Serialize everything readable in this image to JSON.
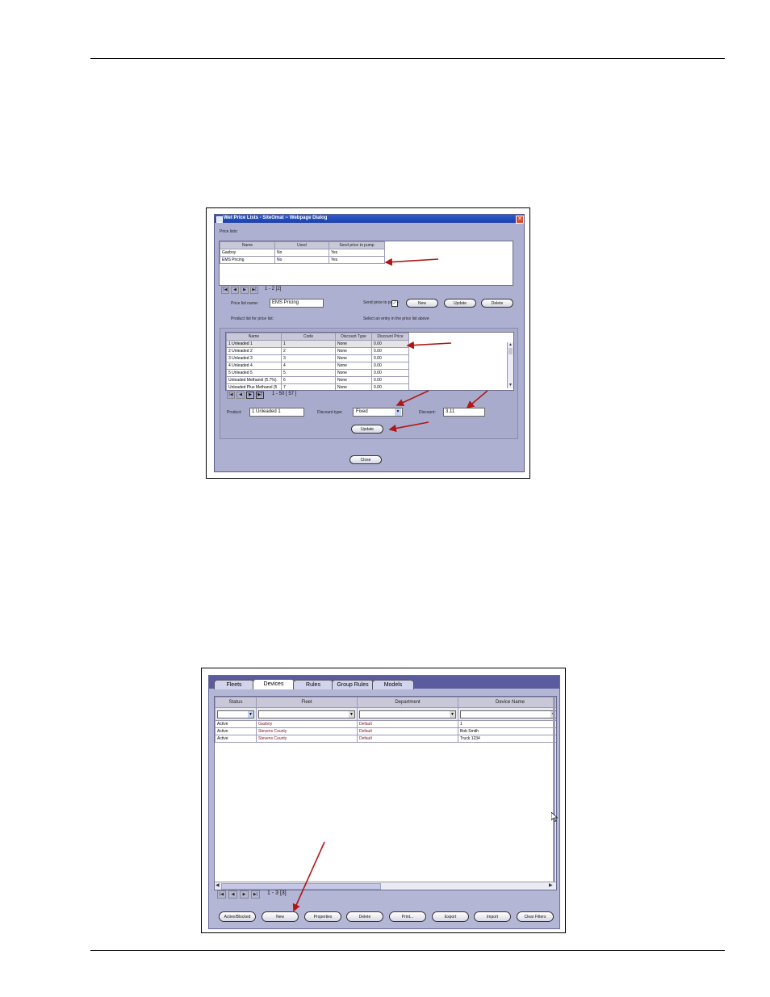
{
  "dialog1": {
    "title": "Wet Price Lists - SiteOmat -- Webpage Dialog",
    "price_lists_label": "Price lists:",
    "price_table": {
      "columns": [
        "Name",
        "Used",
        "Send price to pump"
      ],
      "rows": [
        [
          "Gasboy",
          "No",
          "Yes"
        ],
        [
          "EMS Pricing",
          "No",
          "Yes"
        ]
      ]
    },
    "pager1": "1 - 2 [2]",
    "price_list_name_label": "Price list name:",
    "price_list_name_value": "EMS Pricing",
    "send_price_label": "Send price to pump:",
    "new_button": "New",
    "update_button": "Update",
    "delete_button": "Delete",
    "product_list_label": "Product list for price list:",
    "select_entry_label": "Select an entry in the price list above",
    "product_table": {
      "columns": [
        "Name",
        "Code",
        "Discount Type",
        "Discount Price"
      ],
      "rows": [
        [
          "1 Unleaded 1",
          "1",
          "None",
          "0.00"
        ],
        [
          "2 Unleaded 2",
          "2",
          "None",
          "0.00"
        ],
        [
          "3 Unleaded 3",
          "3",
          "None",
          "0.00"
        ],
        [
          "4 Unleaded 4",
          "4",
          "None",
          "0.00"
        ],
        [
          "5 Unleaded 5",
          "5",
          "None",
          "0.00"
        ],
        [
          "Unleaded Methanol (5.7%)",
          "6",
          "None",
          "0.00"
        ],
        [
          "Unleaded Plus Methanol (5",
          "7",
          "None",
          "0.00"
        ]
      ]
    },
    "pager2": "1 - 50 [ 57 ]",
    "product_label": "Product:",
    "product_value": "1 Unleaded 1",
    "discount_type_label": "Discount type:",
    "discount_type_value": "Fixed",
    "discount_label": "Discount:",
    "discount_value": "3.11",
    "update_button2": "Update",
    "close_button": "Close"
  },
  "dialog2": {
    "tabs": [
      "Fleets",
      "Devices",
      "Rules",
      "Group Rules",
      "Models"
    ],
    "active_tab": "Devices",
    "columns": [
      "Status",
      "Fleet",
      "Department",
      "Device Name"
    ],
    "rows": [
      [
        "Active",
        "Gasboy",
        "Default",
        "1"
      ],
      [
        "Active",
        "Stevens County",
        "Default",
        "Bob Smith"
      ],
      [
        "Active",
        "Stevens County",
        "Default",
        "Truck 1234"
      ]
    ],
    "pager": "1 - 3 [3]",
    "buttons": [
      "Active/Blocked",
      "New",
      "Properties",
      "Delete",
      "Print...",
      "Export",
      "Import",
      "Clear Filters"
    ]
  }
}
